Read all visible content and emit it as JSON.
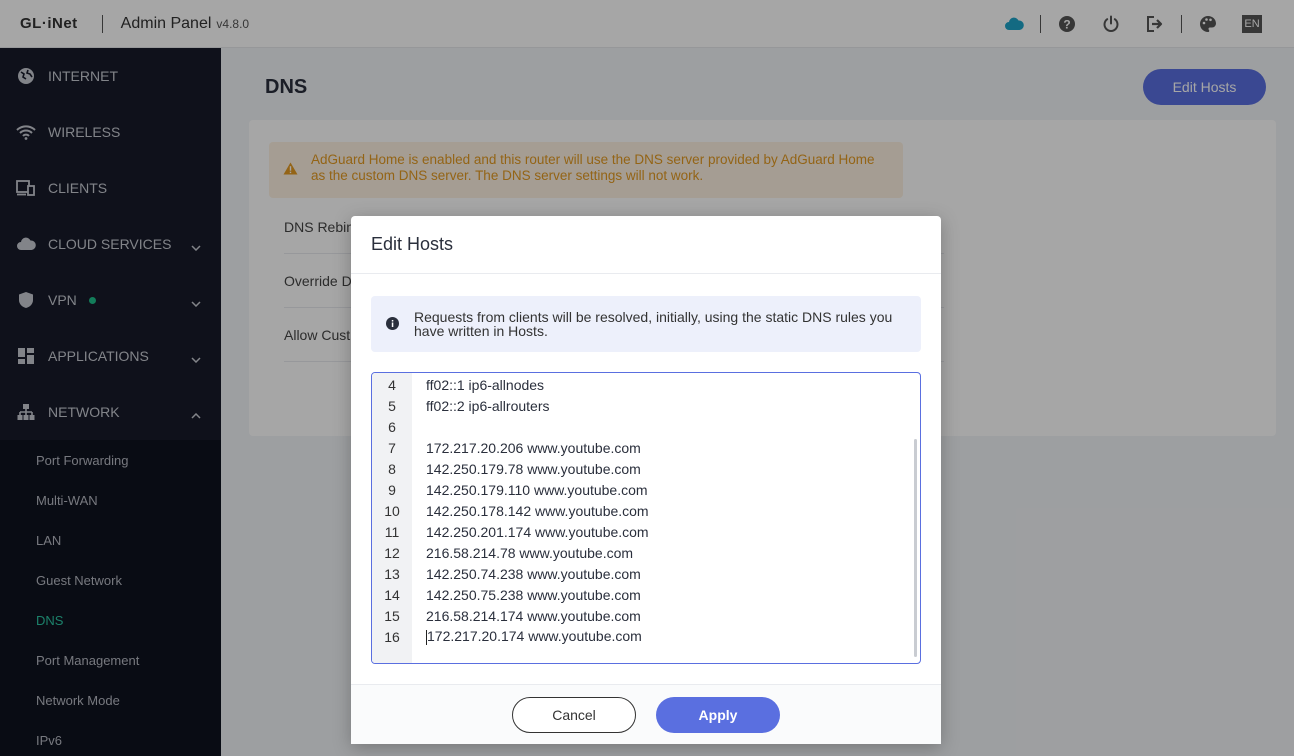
{
  "header": {
    "logo": "GL·iNet",
    "title": "Admin Panel",
    "version": "v4.8.0",
    "lang": "EN",
    "icons": [
      "cloud-icon",
      "help-icon",
      "power-icon",
      "logout-icon",
      "palette-icon"
    ]
  },
  "sidebar": {
    "items": [
      {
        "label": "INTERNET",
        "icon": "globe-icon"
      },
      {
        "label": "WIRELESS",
        "icon": "wifi-icon"
      },
      {
        "label": "CLIENTS",
        "icon": "devices-icon"
      },
      {
        "label": "CLOUD SERVICES",
        "icon": "cloud-icon"
      },
      {
        "label": "VPN",
        "icon": "shield-icon"
      },
      {
        "label": "APPLICATIONS",
        "icon": "apps-icon"
      },
      {
        "label": "NETWORK",
        "icon": "network-icon"
      }
    ],
    "network_sub": [
      {
        "label": "Port Forwarding"
      },
      {
        "label": "Multi-WAN"
      },
      {
        "label": "LAN"
      },
      {
        "label": "Guest Network"
      },
      {
        "label": "DNS"
      },
      {
        "label": "Port Management"
      },
      {
        "label": "Network Mode"
      },
      {
        "label": "IPv6"
      }
    ],
    "active_sub": "DNS"
  },
  "main": {
    "title": "DNS",
    "edit_hosts_button": "Edit Hosts",
    "warning": "AdGuard Home is enabled and this router will use the DNS server provided by AdGuard Home as the custom DNS server. The DNS server settings will not work.",
    "settings": [
      {
        "label": "DNS Rebin"
      },
      {
        "label": "Override D"
      },
      {
        "label": "Allow Cust"
      }
    ]
  },
  "dialog": {
    "title": "Edit Hosts",
    "info": "Requests from clients will be resolved, initially, using the static DNS rules you have written in Hosts.",
    "lines": [
      {
        "n": "4",
        "text": "ff02::1 ip6-allnodes"
      },
      {
        "n": "5",
        "text": "ff02::2 ip6-allrouters"
      },
      {
        "n": "6",
        "text": ""
      },
      {
        "n": "7",
        "text": "172.217.20.206 www.youtube.com"
      },
      {
        "n": "8",
        "text": "142.250.179.78 www.youtube.com"
      },
      {
        "n": "9",
        "text": "142.250.179.110 www.youtube.com"
      },
      {
        "n": "10",
        "text": "142.250.178.142 www.youtube.com"
      },
      {
        "n": "11",
        "text": "142.250.201.174 www.youtube.com"
      },
      {
        "n": "12",
        "text": "216.58.214.78 www.youtube.com"
      },
      {
        "n": "13",
        "text": "142.250.74.238 www.youtube.com"
      },
      {
        "n": "14",
        "text": "142.250.75.238 www.youtube.com"
      },
      {
        "n": "15",
        "text": "216.58.214.174 www.youtube.com"
      },
      {
        "n": "16",
        "text": "172.217.20.174 www.youtube.com"
      }
    ],
    "cancel_label": "Cancel",
    "apply_label": "Apply"
  },
  "colors": {
    "accent": "#5a6fe0",
    "sidebar_bg": "#171b2a",
    "active_sub": "#2bc6a3",
    "warning_text": "#e39a22",
    "warning_bg": "#fdf2e2",
    "info_bg": "#edf0fb",
    "cloud": "#1ea3c8"
  }
}
